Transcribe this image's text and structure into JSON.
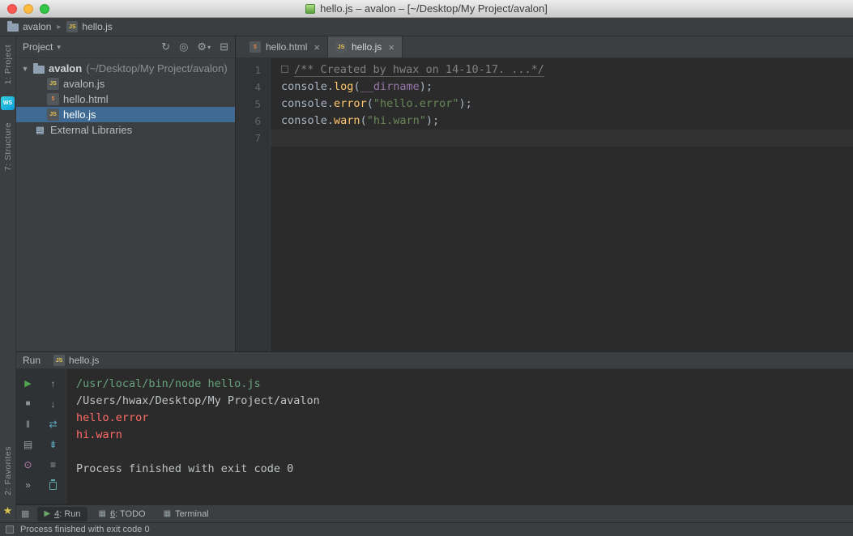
{
  "colors": {
    "selection": "#3e6a94",
    "stderr": "#ff6b68",
    "cmd-green": "#67a37c",
    "string-green": "#6a8759",
    "func-yellow": "#ffc66d",
    "member-purple": "#9876aa",
    "comment-gray": "#808080",
    "code-text": "#a9b7c6"
  },
  "titlebar": {
    "title": "hello.js – avalon – [~/Desktop/My Project/avalon]"
  },
  "breadcrumb": {
    "project": "avalon",
    "separator": "▸",
    "file": "hello.js"
  },
  "stripe": {
    "project": "1: Project",
    "ws_badge": "WS",
    "structure": "7: Structure",
    "favorites": "2: Favorites",
    "star": "★"
  },
  "project_panel": {
    "title": "Project",
    "root": {
      "arrow": "▼",
      "name": "avalon",
      "path": "(~/Desktop/My Project/avalon)"
    },
    "files": {
      "avalon_js": "avalon.js",
      "hello_html": "hello.html",
      "hello_js": "hello.js",
      "external_libraries": "External Libraries"
    }
  },
  "editor_tabs": {
    "hello_html": "hello.html",
    "hello_js": "hello.js",
    "close": "×"
  },
  "editor": {
    "line_numbers": [
      "1",
      "4",
      "5",
      "6",
      "7"
    ],
    "line1_comment": "/** Created by hwax on 14-10-17. ...*/",
    "line4": {
      "obj": "console",
      "dot": ".",
      "method": "log",
      "paren_open": "(",
      "arg": "__dirname",
      "paren_close": ");"
    },
    "line5": {
      "obj": "console",
      "dot": ".",
      "method": "error",
      "paren_open": "(",
      "str": "\"hello.error\"",
      "paren_close": ");"
    },
    "line6": {
      "obj": "console",
      "dot": ".",
      "method": "warn",
      "paren_open": "(",
      "str": "\"hi.warn\"",
      "paren_close": ");"
    }
  },
  "run_panel": {
    "title": "Run",
    "tab_file": "hello.js",
    "output": {
      "cmd": "/usr/local/bin/node hello.js",
      "cwd": "/Users/hwax/Desktop/My Project/avalon",
      "err1": "hello.error",
      "warn1": "hi.warn",
      "exit": "Process finished with exit code 0"
    }
  },
  "bottom_bar": {
    "run": {
      "mnemonic": "4",
      "rest": ": Run"
    },
    "todo": {
      "mnemonic": "6",
      "rest": ": TODO"
    },
    "terminal": "Terminal"
  },
  "status_bar": {
    "message": "Process finished with exit code 0"
  },
  "icons": {
    "js_badge": "JS",
    "html_badge": "5",
    "lib_glyph": "▤",
    "tree_arrow": "▼",
    "caret": "▾",
    "sync": "↻",
    "locate": "◎",
    "settings": "⚙",
    "hide": "⊟",
    "rerun": "▶",
    "stop": "■",
    "pause": "‖",
    "restore": "▤",
    "pin": "⊙",
    "more": "»",
    "up": "↑",
    "down": "↓",
    "softwrap": "⇄",
    "scrollend": "⇟",
    "print": "≡",
    "switcher": "▦",
    "run_tab": "▶",
    "todo_tab": "▦",
    "terminal_tab": "▦"
  }
}
